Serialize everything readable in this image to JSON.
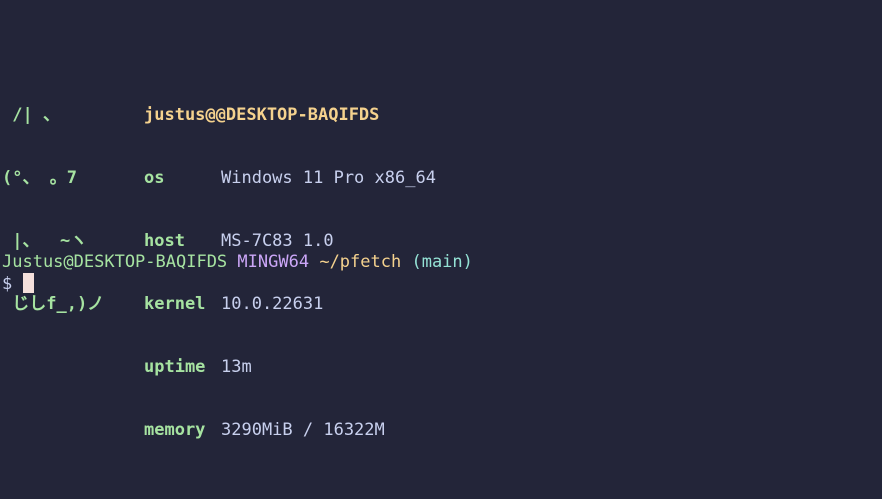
{
  "ascii_art": {
    "lines": [
      " /| 、",
      "(°、 。7",
      " |、  ~ヽ",
      " じしf_,)ノ"
    ]
  },
  "info": {
    "title": "justus@@DESKTOP-BAQIFDS",
    "rows": [
      {
        "key": "os",
        "value": "Windows 11 Pro x86_64"
      },
      {
        "key": "host",
        "value": "MS-7C83 1.0"
      },
      {
        "key": "kernel",
        "value": "10.0.22631"
      },
      {
        "key": "uptime",
        "value": "13m"
      },
      {
        "key": "memory",
        "value": "3290MiB / 16322M"
      }
    ]
  },
  "prompt": {
    "user_host": "Justus@DESKTOP-BAQIFDS",
    "system": "MINGW64",
    "path": "~/pfetch",
    "branch": "(main)",
    "symbol": "$"
  },
  "colors": {
    "background": "#232539",
    "green": "#a6e3a1",
    "yellow": "#f5d28e",
    "purple": "#cba6f7",
    "teal": "#94e2d5",
    "text": "#c8d0ee",
    "cursor": "#f5e0dc"
  }
}
